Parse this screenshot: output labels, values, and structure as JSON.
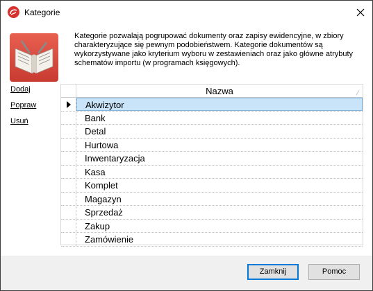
{
  "window": {
    "title": "Kategorie",
    "colors": {
      "accent": "#d6322e",
      "selection": "#c9e3f8",
      "selection_border": "#7fb4e0"
    }
  },
  "description": "Kategorie pozwalają pogrupować dokumenty oraz zapisy ewidencyjne, w zbiory charakteryzujące się pewnym podobieństwem. Kategorie dokumentów są wykorzystywane jako kryterium wyboru w zestawieniach oraz jako główne atrybuty schematów importu (w programach księgowych).",
  "actions": {
    "add": "Dodaj",
    "edit": "Popraw",
    "delete": "Usuń"
  },
  "grid": {
    "column_header": "Nazwa",
    "selected_index": 0,
    "rows": [
      "Akwizytor",
      "Bank",
      "Detal",
      "Hurtowa",
      "Inwentaryzacja",
      "Kasa",
      "Komplet",
      "Magazyn",
      "Sprzedaż",
      "Zakup",
      "Zamówienie"
    ]
  },
  "buttons": {
    "close": "Zamknij",
    "help": "Pomoc"
  }
}
